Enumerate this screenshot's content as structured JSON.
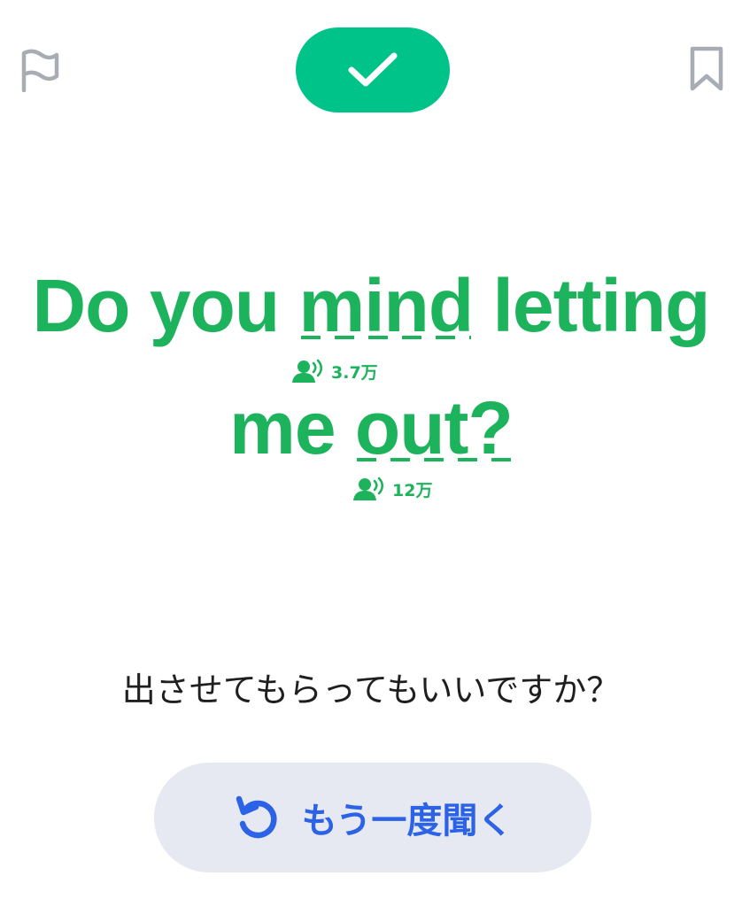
{
  "top_bar": {
    "left_icon": "flag-icon",
    "center_icon": "checkmark-icon",
    "right_icon": "bookmark-icon",
    "check_color": "#00c389"
  },
  "sentence": {
    "line1": {
      "before": "Do you ",
      "highlight": "mind",
      "after": " letting"
    },
    "line2": {
      "before": "me ",
      "highlight": "out?",
      "after": ""
    },
    "color": "#1db35c"
  },
  "word_stats": [
    {
      "icon": "speaking-person-icon",
      "count": "3.7万"
    },
    {
      "icon": "speaking-person-icon",
      "count": "12万"
    }
  ],
  "translation": "出させてもらってもいいですか？",
  "replay_button": {
    "icon": "replay-icon",
    "label": "もう一度聞く",
    "color": "#2b62e6"
  }
}
